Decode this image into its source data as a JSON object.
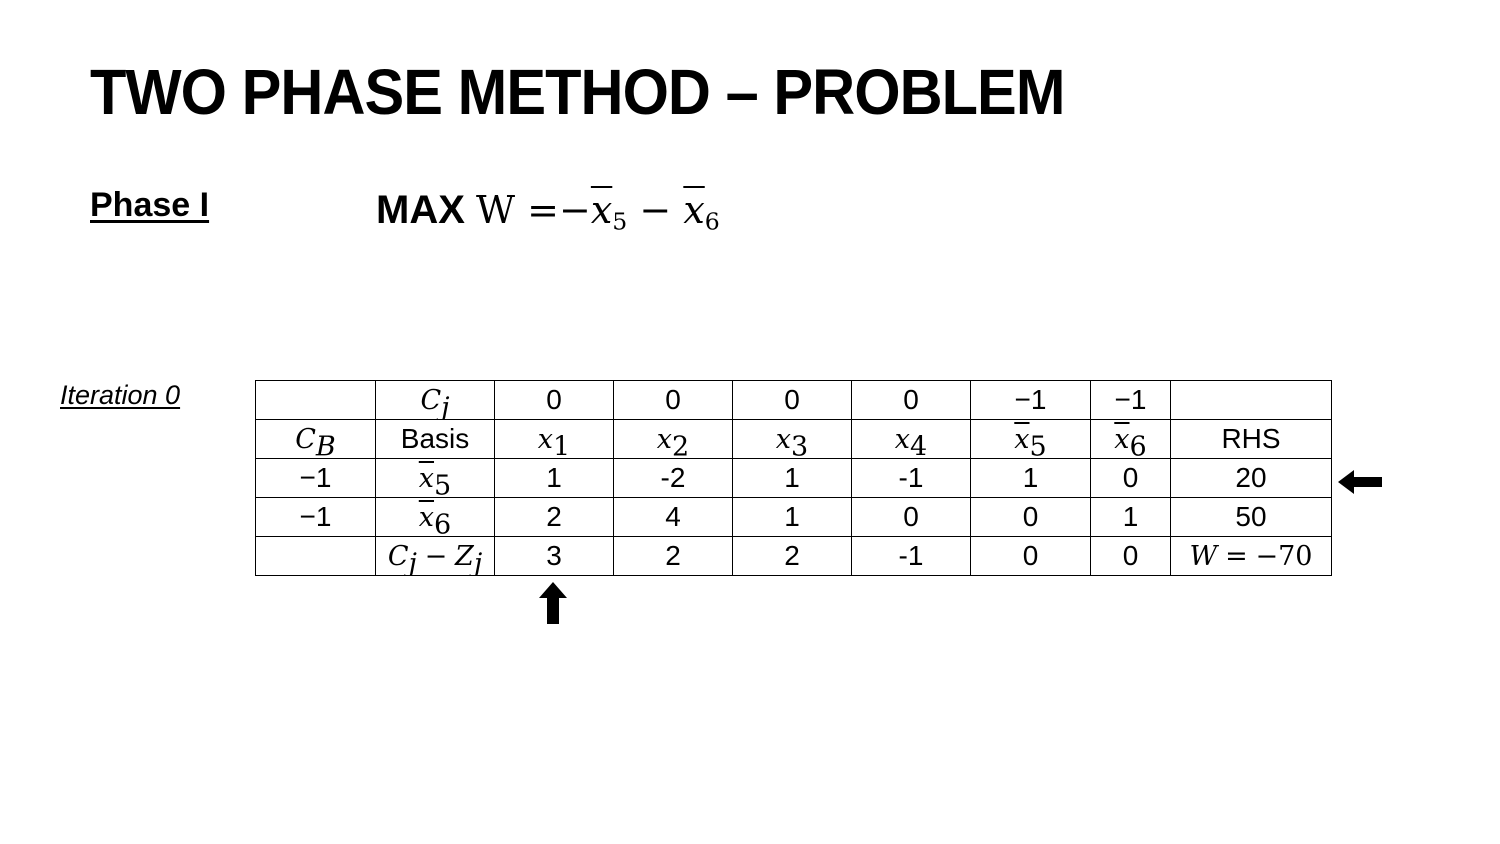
{
  "title": "TWO PHASE METHOD – PROBLEM",
  "phase_label": "Phase I",
  "objective": {
    "keyword": "MAX",
    "variable": "W",
    "equals": "=",
    "minus": "−",
    "var_base": "x",
    "term1_sub": "5",
    "term2_sub": "6"
  },
  "iteration_label": "Iteration 0",
  "tableau": {
    "cj_row": {
      "label_base": "C",
      "label_sub": "j",
      "values": [
        "0",
        "0",
        "0",
        "0",
        "−1",
        "−1"
      ]
    },
    "header_row": {
      "cb_base": "C",
      "cb_sub": "B",
      "basis": "Basis",
      "var_base": "x",
      "var_subs": [
        "1",
        "2",
        "3",
        "4",
        "5",
        "6"
      ],
      "rhs": "RHS"
    },
    "rows": [
      {
        "cb": "−1",
        "basis_base": "x",
        "basis_sub": "5",
        "values": [
          "1",
          "-2",
          "1",
          "-1",
          "1",
          "0"
        ],
        "rhs": "20"
      },
      {
        "cb": "−1",
        "basis_base": "x",
        "basis_sub": "6",
        "values": [
          "2",
          "4",
          "1",
          "0",
          "0",
          "1"
        ],
        "rhs": "50"
      }
    ],
    "cz_row": {
      "label_c": "C",
      "label_c_sub": "j",
      "minus": "−",
      "label_z": "Z",
      "label_z_sub": "j",
      "values": [
        "3",
        "2",
        "2",
        "-1",
        "0",
        "0"
      ],
      "w_var": "W",
      "w_equals": "=",
      "w_value": "−70"
    }
  },
  "icons": {
    "leaving_row_marker": "arrow-left-icon",
    "entering_column_marker": "arrow-up-icon"
  }
}
